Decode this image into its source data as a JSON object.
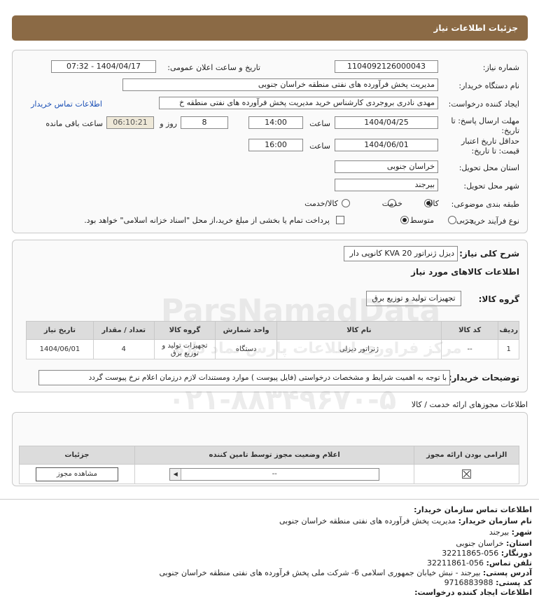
{
  "header": {
    "title": "جزئیات اطلاعات نیاز"
  },
  "need": {
    "need_number_label": "شماره نیاز:",
    "need_number": "1104092126000043",
    "announce_label": "تاریخ و ساعت اعلان عمومی:",
    "announce_value": "1404/04/17 - 07:32",
    "buyer_label": "نام دستگاه خریدار:",
    "buyer_value": "مدیریت پخش فرآورده های نفتی منطقه خراسان جنوبی",
    "creator_label": "ایجاد کننده درخواست:",
    "creator_value": "مهدی نادری بروجردی کارشناس خرید مدیریت پخش فرآورده های نفتی منطقه خ",
    "contact_link": "اطلاعات تماس خریدار",
    "deadline_label_1": "مهلت ارسال پاسخ: تا",
    "deadline_label_2": "تاریخ:",
    "deadline_date": "1404/04/25",
    "time_label": "ساعت",
    "deadline_time": "14:00",
    "days_value": "8",
    "days_label": "روز و",
    "remaining_value": "06:10:21",
    "remaining_label": "ساعت باقی مانده",
    "validity_label_1": "حداقل تاریخ اعتبار",
    "validity_label_2": "قیمت: تا تاریخ:",
    "validity_date": "1404/06/01",
    "validity_time": "16:00",
    "province_label": "استان محل تحویل:",
    "province_value": "خراسان جنوبی",
    "city_label": "شهر محل تحویل:",
    "city_value": "بیرجند",
    "category_label": "طبقه بندی موضوعی:",
    "category_options": [
      "کالا",
      "خدمت",
      "کالا/خدمت"
    ],
    "process_label": "نوع فرآیند خرید :",
    "process_options": [
      "جزیی",
      "متوسط"
    ],
    "payment_text": "پرداخت تمام یا بخشی از مبلغ خرید،از محل \"اسناد خزانه اسلامی\" خواهد بود."
  },
  "summary": {
    "title_label": "شرح کلی نیاز:",
    "title_value": "دیزل ژنراتور 20 KVA کانوپی دار",
    "goods_info_label": "اطلاعات کالاهای مورد نیاز",
    "group_label": "گروه کالا:",
    "group_value": "تجهیزات تولید و توزیع برق",
    "columns": [
      "ردیف",
      "کد کالا",
      "نام کالا",
      "واحد شمارش",
      "گروه کالا",
      "تعداد / مقدار",
      "تاریخ نیاز"
    ],
    "rows": [
      [
        "1",
        "--",
        "ژنراتور دیزلی",
        "دستگاه",
        "تجهیزات تولید و توزیع برق",
        "4",
        "1404/06/01"
      ]
    ],
    "buyer_notes_label": "توضیحات خریدار:",
    "buyer_notes_value": "با توجه به اهمیت شرایط و مشخصات درخواستی (فایل پیوست ) موارد ومستندات لازم درزمان اعلام نرخ پیوست گردد"
  },
  "permits": {
    "section_title": "اطلاعات مجوزهای ارائه خدمت / کالا",
    "columns": [
      "الزامی بودن ارائه مجوز",
      "اعلام وضعیت مجوز توسط تامین کننده",
      "جزئیات"
    ],
    "select_value": "--",
    "view_button": "مشاهده مجوز"
  },
  "contact": {
    "title": "اطلاعات تماس سازمان خریدار:",
    "org_label": "نام سازمان خریدار:",
    "org_value": "مدیریت پخش فرآورده های نفتی منطقه خراسان جنوبی",
    "city_label": "شهر:",
    "city_value": "بیرجند",
    "province_label": "استان:",
    "province_value": "خراسان جنوبی",
    "fax_label": "دورنگار:",
    "fax_value": "056-32211865",
    "phone_label": "تلفن تماس:",
    "phone_value": "056-32211861",
    "address_label": "آدرس پستی:",
    "address_value": "بیرجند - نبش خیابان جمهوری اسلامی 6- شرکت ملی پخش فرآورده های نفتی منطقه خراسان جنوبی",
    "postal_label": "کد پستی:",
    "postal_value": "9716883988",
    "requester_label": "اطلاعات ایجاد کننده درخواست:"
  },
  "watermark": {
    "phone": "۰۲۱-۸۸۳۴۹۶۷۰-۵",
    "brand": "ParsNamadData",
    "tagline": "مرکز فراوری اطلاعات پارس نماد داده"
  }
}
